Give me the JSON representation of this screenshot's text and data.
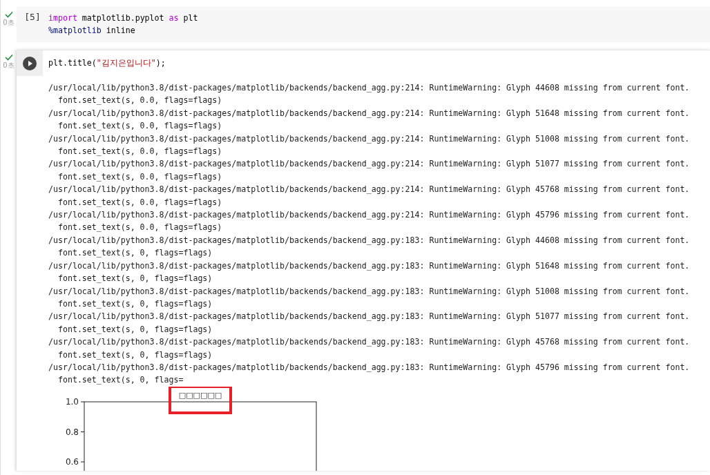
{
  "cells": [
    {
      "completed": true,
      "time": "0초",
      "prompt": "[5]",
      "focused": false,
      "lines": [
        [
          {
            "kind": "keyword",
            "text": "import"
          },
          {
            "kind": "plain",
            "text": " matplotlib.pyplot "
          },
          {
            "kind": "keyword",
            "text": "as"
          },
          {
            "kind": "plain",
            "text": " plt"
          }
        ],
        [
          {
            "kind": "magic",
            "text": "%matplotlib"
          },
          {
            "kind": "plain",
            "text": " inline"
          }
        ]
      ]
    },
    {
      "completed": true,
      "time": "0초",
      "focused": true,
      "lines": [
        [
          {
            "kind": "plain",
            "text": "plt.title("
          },
          {
            "kind": "string",
            "text": "\"김지은입니다\""
          },
          {
            "kind": "plain",
            "text": ");"
          }
        ]
      ],
      "output": [
        "/usr/local/lib/python3.8/dist-packages/matplotlib/backends/backend_agg.py:214: RuntimeWarning: Glyph 44608 missing from current font.",
        "  font.set_text(s, 0.0, flags=flags)",
        "/usr/local/lib/python3.8/dist-packages/matplotlib/backends/backend_agg.py:214: RuntimeWarning: Glyph 51648 missing from current font.",
        "  font.set_text(s, 0.0, flags=flags)",
        "/usr/local/lib/python3.8/dist-packages/matplotlib/backends/backend_agg.py:214: RuntimeWarning: Glyph 51008 missing from current font.",
        "  font.set_text(s, 0.0, flags=flags)",
        "/usr/local/lib/python3.8/dist-packages/matplotlib/backends/backend_agg.py:214: RuntimeWarning: Glyph 51077 missing from current font.",
        "  font.set_text(s, 0.0, flags=flags)",
        "/usr/local/lib/python3.8/dist-packages/matplotlib/backends/backend_agg.py:214: RuntimeWarning: Glyph 45768 missing from current font.",
        "  font.set_text(s, 0.0, flags=flags)",
        "/usr/local/lib/python3.8/dist-packages/matplotlib/backends/backend_agg.py:214: RuntimeWarning: Glyph 45796 missing from current font.",
        "  font.set_text(s, 0.0, flags=flags)",
        "/usr/local/lib/python3.8/dist-packages/matplotlib/backends/backend_agg.py:183: RuntimeWarning: Glyph 44608 missing from current font.",
        "  font.set_text(s, 0, flags=flags)",
        "/usr/local/lib/python3.8/dist-packages/matplotlib/backends/backend_agg.py:183: RuntimeWarning: Glyph 51648 missing from current font.",
        "  font.set_text(s, 0, flags=flags)",
        "/usr/local/lib/python3.8/dist-packages/matplotlib/backends/backend_agg.py:183: RuntimeWarning: Glyph 51008 missing from current font.",
        "  font.set_text(s, 0, flags=flags)",
        "/usr/local/lib/python3.8/dist-packages/matplotlib/backends/backend_agg.py:183: RuntimeWarning: Glyph 51077 missing from current font.",
        "  font.set_text(s, 0, flags=flags)",
        "/usr/local/lib/python3.8/dist-packages/matplotlib/backends/backend_agg.py:183: RuntimeWarning: Glyph 45768 missing from current font.",
        "  font.set_text(s, 0, flags=flags)",
        "/usr/local/lib/python3.8/dist-packages/matplotlib/backends/backend_agg.py:183: RuntimeWarning: Glyph 45796 missing from current font.",
        "  font.set_text(s, 0, flags="
      ],
      "plot": {
        "title": "□□□□□□",
        "y_tick_labels": [
          "1.0",
          "0.8",
          "0.6"
        ]
      },
      "title_highlighted": true
    }
  ]
}
